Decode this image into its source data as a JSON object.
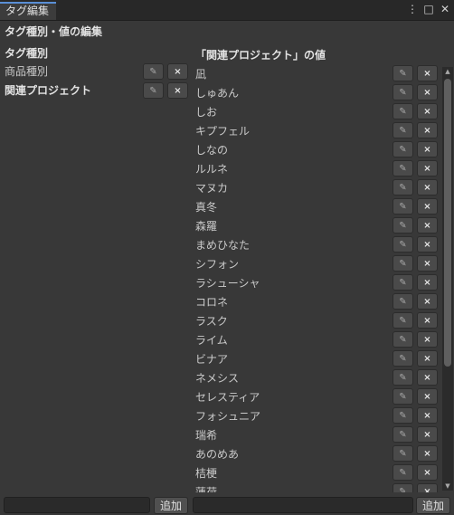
{
  "window": {
    "tab_title": "タグ編集",
    "menu_icon": "⋮",
    "maximize_icon": "□",
    "close_icon": "✕"
  },
  "header": "タグ種別・値の編集",
  "left": {
    "section_label": "タグ種別",
    "items": [
      {
        "label": "商品種別",
        "bold": false
      },
      {
        "label": "関連プロジェクト",
        "bold": true
      }
    ]
  },
  "right": {
    "title": "「関連プロジェクト」の値",
    "items": [
      "凪",
      "しゅあん",
      "しお",
      "キプフェル",
      "しなの",
      "ルルネ",
      "マヌカ",
      "真冬",
      "森羅",
      "まめひなた",
      "シフォン",
      "ラシューシャ",
      "コロネ",
      "ラスク",
      "ライム",
      "ビナア",
      "ネメシス",
      "セレスティア",
      "フォシュニア",
      "瑞希",
      "あのめあ",
      "桔梗",
      "蓮荷"
    ]
  },
  "buttons": {
    "edit_glyph": "✎",
    "delete_glyph": "×"
  },
  "footer": {
    "left_input_value": "",
    "left_add_label": "追加",
    "right_input_value": "",
    "right_add_label": "追加"
  },
  "scrollbar": {
    "up_glyph": "▲",
    "down_glyph": "▼"
  }
}
